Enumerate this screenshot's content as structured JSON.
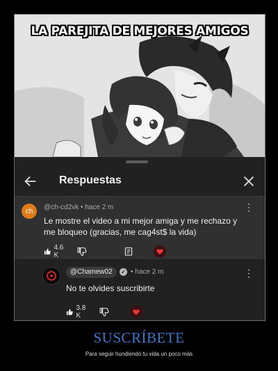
{
  "meme": {
    "title": "LA PAREJITA DE MEJORES AMIGOS"
  },
  "panel": {
    "title": "Respuestas",
    "icons": {
      "back": "arrow-left-icon",
      "close": "close-icon"
    }
  },
  "comments": [
    {
      "avatar_text": "ch",
      "author": "@ch-cd2vk",
      "time": "hace 2 m",
      "text": "Le mostre el video a mi mejor amiga y me rechazo y me bloqueo (gracias, me cag4st$ la vida)",
      "likes": "4.6 K"
    },
    {
      "author": "@Chamew02",
      "time": "hace 2 m",
      "text": "No te olvides suscribirte",
      "likes": "3.8 K"
    }
  ],
  "caption": {
    "title": "SUSCRÍBETE",
    "subtitle": "Para seguir hundiendo tu vida un poco más"
  },
  "colors": {
    "accent": "#3d78c9",
    "avatar_orange": "#e07b1a",
    "panel_bg": "#212121",
    "highlight_bg": "#303030"
  }
}
